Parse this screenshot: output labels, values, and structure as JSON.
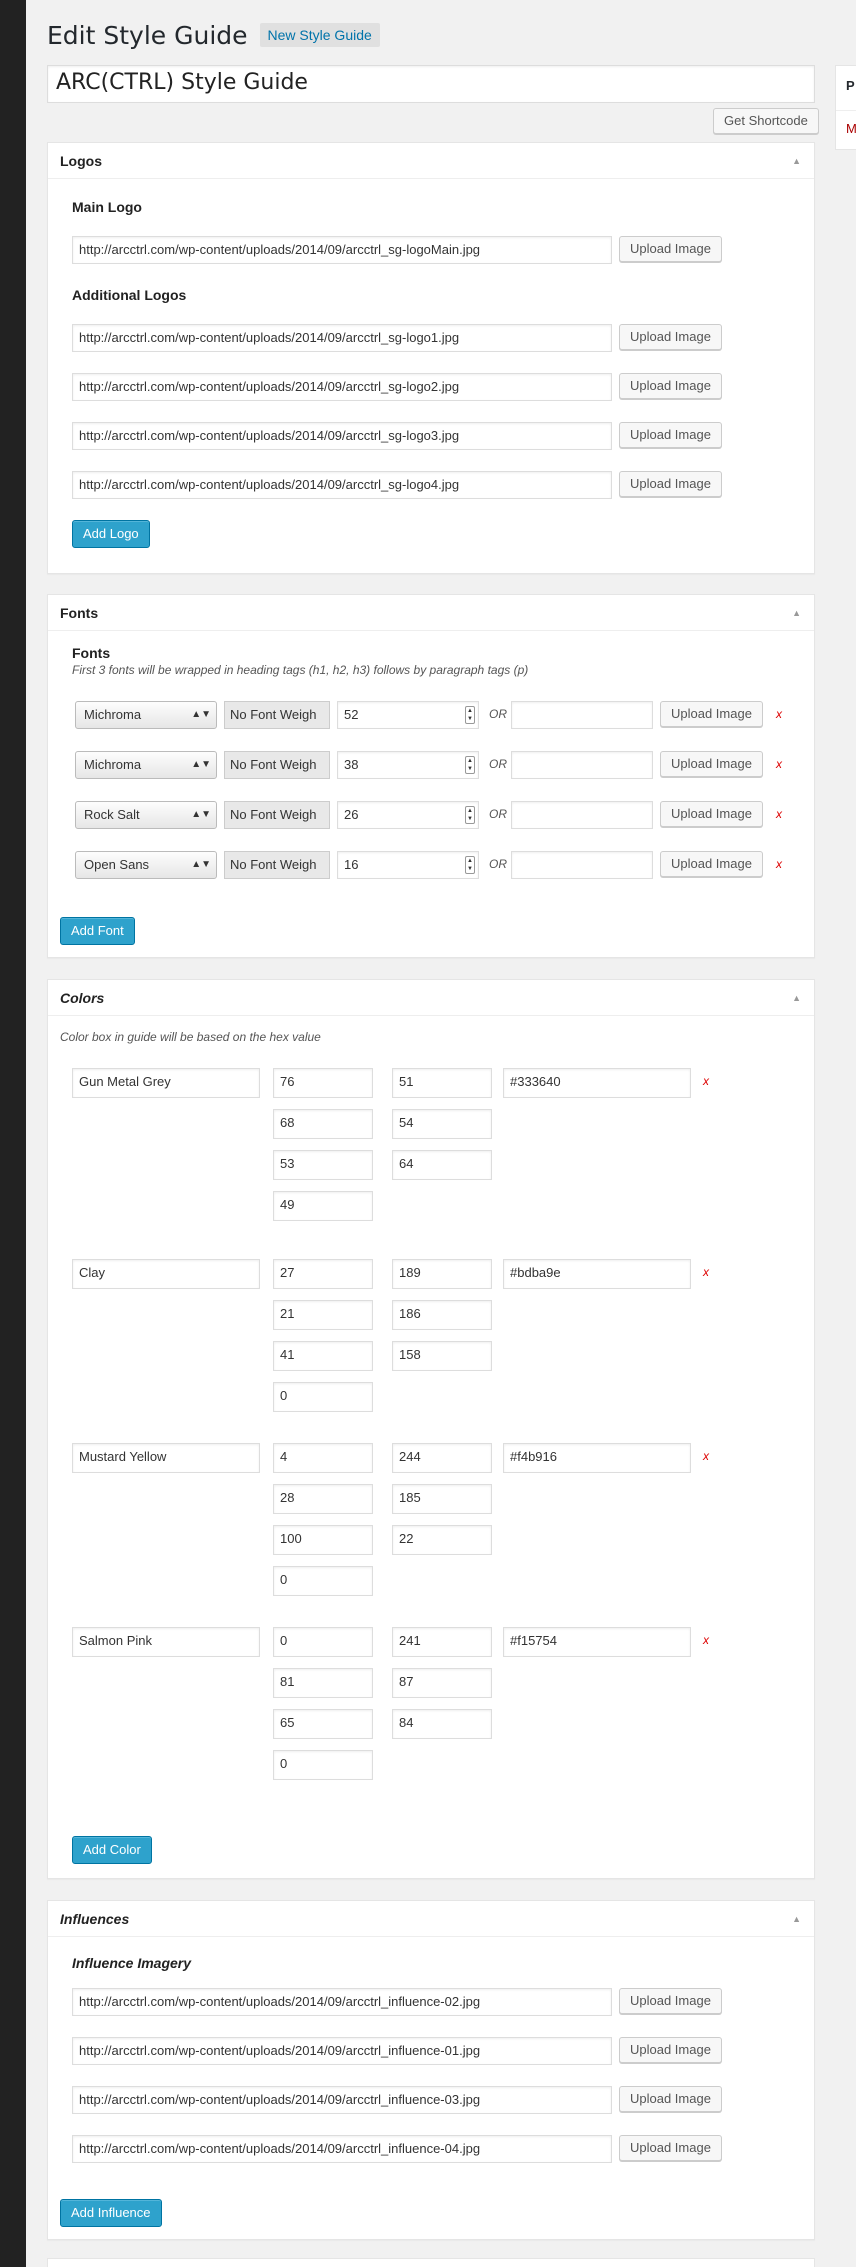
{
  "header": {
    "title": "Edit Style Guide",
    "add_new": "New Style Guide"
  },
  "post_title": "ARC(CTRL) Style Guide",
  "shortcode_button": "Get Shortcode",
  "side_box": {
    "title": "P",
    "link": "M"
  },
  "toggle_glyph": "▲",
  "upload_label": "Upload Image",
  "logos": {
    "title": "Logos",
    "main_label": "Main Logo",
    "main_url": "http://arcctrl.com/wp-content/uploads/2014/09/arcctrl_sg-logoMain.jpg",
    "additional_label": "Additional Logos",
    "additional": [
      "http://arcctrl.com/wp-content/uploads/2014/09/arcctrl_sg-logo1.jpg",
      "http://arcctrl.com/wp-content/uploads/2014/09/arcctrl_sg-logo2.jpg",
      "http://arcctrl.com/wp-content/uploads/2014/09/arcctrl_sg-logo3.jpg",
      "http://arcctrl.com/wp-content/uploads/2014/09/arcctrl_sg-logo4.jpg"
    ],
    "add_button": "Add Logo"
  },
  "fonts": {
    "title": "Fonts",
    "label": "Fonts",
    "hint": "First 3 fonts will be wrapped in heading tags (h1, h2, h3) follows by paragraph tags (p)",
    "or_label": "OR",
    "remove_label": "x",
    "rows": [
      {
        "family": "Michroma",
        "weight": "No Font Weigh",
        "size": "52"
      },
      {
        "family": "Michroma",
        "weight": "No Font Weigh",
        "size": "38"
      },
      {
        "family": "Rock Salt",
        "weight": "No Font Weigh",
        "size": "26"
      },
      {
        "family": "Open Sans",
        "weight": "No Font Weigh",
        "size": "16"
      }
    ],
    "add_button": "Add Font"
  },
  "colors": {
    "title": "Colors",
    "hint": "Color box in guide will be based on the hex value",
    "remove_label": "x",
    "items": [
      {
        "name": "Gun Metal Grey",
        "cmyk": [
          "76",
          "68",
          "53",
          "49"
        ],
        "rgb": [
          "51",
          "54",
          "64"
        ],
        "hex": "#333640"
      },
      {
        "name": "Clay",
        "cmyk": [
          "27",
          "21",
          "41",
          "0"
        ],
        "rgb": [
          "189",
          "186",
          "158"
        ],
        "hex": "#bdba9e"
      },
      {
        "name": "Mustard Yellow",
        "cmyk": [
          "4",
          "28",
          "100",
          "0"
        ],
        "rgb": [
          "244",
          "185",
          "22"
        ],
        "hex": "#f4b916"
      },
      {
        "name": "Salmon Pink",
        "cmyk": [
          "0",
          "81",
          "65",
          "0"
        ],
        "rgb": [
          "241",
          "87",
          "84"
        ],
        "hex": "#f15754"
      }
    ],
    "add_button": "Add Color"
  },
  "influences": {
    "title": "Influences",
    "label": "Influence Imagery",
    "urls": [
      "http://arcctrl.com/wp-content/uploads/2014/09/arcctrl_influence-02.jpg",
      "http://arcctrl.com/wp-content/uploads/2014/09/arcctrl_influence-01.jpg",
      "http://arcctrl.com/wp-content/uploads/2014/09/arcctrl_influence-03.jpg",
      "http://arcctrl.com/wp-content/uploads/2014/09/arcctrl_influence-04.jpg"
    ],
    "add_button": "Add Influence"
  }
}
